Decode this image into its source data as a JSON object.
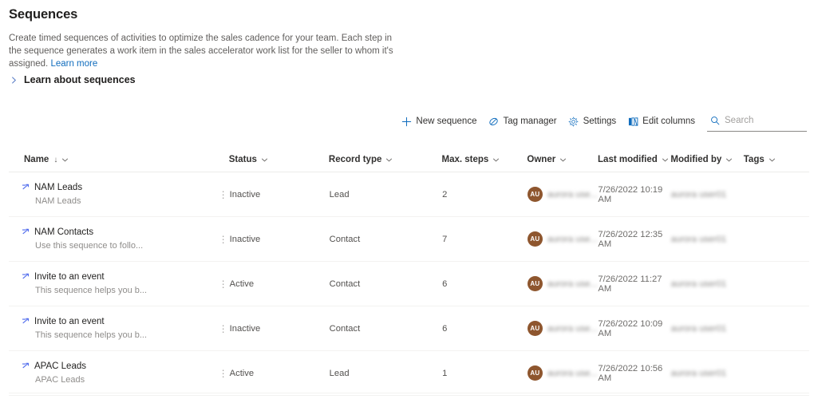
{
  "header": {
    "title": "Sequences",
    "description_part1": "Create timed sequences of activities to optimize the sales cadence for your team. Each step in the sequence generates a work item in the sales accelerator work list for the seller to whom it's assigned. ",
    "learn_more_link": "Learn more"
  },
  "accordion": {
    "label": "Learn about sequences",
    "icon": "chevron-right-icon",
    "expanded": false
  },
  "commandbar": {
    "buttons": [
      {
        "label": "New sequence",
        "icon": "plus-icon"
      },
      {
        "label": "Tag manager",
        "icon": "tag-icon"
      },
      {
        "label": "Settings",
        "icon": "gear-icon"
      },
      {
        "label": "Edit columns",
        "icon": "edit-columns-icon"
      }
    ],
    "search": {
      "placeholder": "Search",
      "value": "",
      "icon": "search-icon"
    }
  },
  "grid": {
    "columns": [
      {
        "label": "Name",
        "sorted": true,
        "sort_dir": "↓"
      },
      {
        "label": "Status"
      },
      {
        "label": "Record type"
      },
      {
        "label": "Max. steps"
      },
      {
        "label": "Owner"
      },
      {
        "label": "Last modified"
      },
      {
        "label": "Modified by"
      },
      {
        "label": "Tags"
      }
    ],
    "rows": [
      {
        "name": "NAM Leads",
        "subtitle": "NAM Leads",
        "status": "Inactive",
        "record_type": "Lead",
        "max_steps": "2",
        "owner_initials": "AU",
        "owner_name": "aurora use...",
        "last_modified": "7/26/2022 10:19 AM",
        "modified_by": "aurora user01",
        "tags": ""
      },
      {
        "name": "NAM Contacts",
        "subtitle": "Use this sequence to follo...",
        "status": "Inactive",
        "record_type": "Contact",
        "max_steps": "7",
        "owner_initials": "AU",
        "owner_name": "aurora use...",
        "last_modified": "7/26/2022 12:35 AM",
        "modified_by": "aurora user01",
        "tags": ""
      },
      {
        "name": "Invite to an event",
        "subtitle": "This sequence helps you b...",
        "status": "Active",
        "record_type": "Contact",
        "max_steps": "6",
        "owner_initials": "AU",
        "owner_name": "aurora use...",
        "last_modified": "7/26/2022 11:27 AM",
        "modified_by": "aurora user01",
        "tags": ""
      },
      {
        "name": "Invite to an event",
        "subtitle": "This sequence helps you b...",
        "status": "Inactive",
        "record_type": "Contact",
        "max_steps": "6",
        "owner_initials": "AU",
        "owner_name": "aurora use...",
        "last_modified": "7/26/2022 10:09 AM",
        "modified_by": "aurora user01",
        "tags": ""
      },
      {
        "name": "APAC Leads",
        "subtitle": "APAC Leads",
        "status": "Active",
        "record_type": "Lead",
        "max_steps": "1",
        "owner_initials": "AU",
        "owner_name": "aurora use...",
        "last_modified": "7/26/2022 10:56 AM",
        "modified_by": "aurora user01",
        "tags": ""
      }
    ],
    "row_menu_icon": "more-vertical-icon",
    "row_icon": "sequence-icon"
  },
  "colors": {
    "accent": "#0f6cbd",
    "link": "#0f6cbd",
    "avatar_bg": "#8e562e",
    "sequence_icon": "#4f6bed",
    "text_primary": "#201f1e",
    "text_secondary": "#605e5c"
  }
}
